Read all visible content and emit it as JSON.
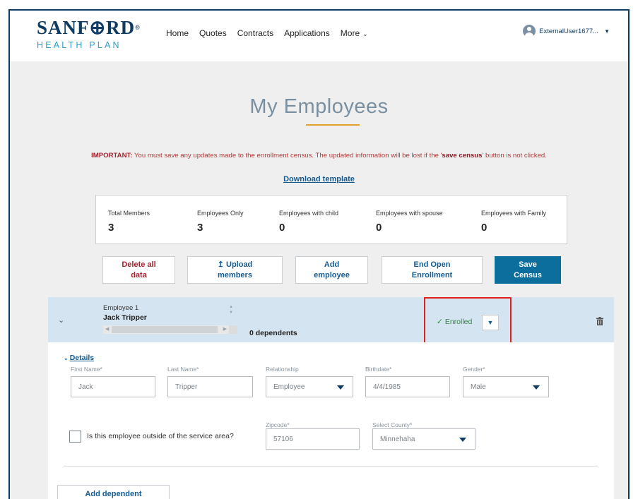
{
  "header": {
    "logo_line1": "SANF⊕RD",
    "logo_line2": "HEALTH PLAN",
    "nav": [
      "Home",
      "Quotes",
      "Contracts",
      "Applications",
      "More"
    ],
    "user_name": "ExternalUser1677..."
  },
  "page_title": "My Employees",
  "notice": {
    "label": "IMPORTANT:",
    "text_before": " You must save any updates made to the enrollment census. The updated information will be lost if the '",
    "strong": "save census",
    "text_after": "' button is not clicked."
  },
  "download_link": "Download template",
  "stats": [
    {
      "label": "Total Members",
      "value": "3"
    },
    {
      "label": "Employees Only",
      "value": "3"
    },
    {
      "label": "Employees with child",
      "value": "0"
    },
    {
      "label": "Employees with spouse",
      "value": "0"
    },
    {
      "label": "Employees with Family",
      "value": "0"
    }
  ],
  "actions": {
    "delete_all": "Delete all data",
    "upload": "Upload members",
    "add_employee": "Add employee",
    "end_enrollment": "End Open Enrollment",
    "save_census": "Save Census"
  },
  "employee": {
    "label": "Employee 1",
    "name": "Jack Tripper",
    "dependents": "0 dependents",
    "status": "Enrolled"
  },
  "details": {
    "toggle": "Details",
    "fields": {
      "first_name": {
        "label": "First Name*",
        "value": "Jack"
      },
      "last_name": {
        "label": "Last Name*",
        "value": "Tripper"
      },
      "relationship": {
        "label": "Relationship",
        "value": "Employee"
      },
      "birthdate": {
        "label": "Birthdate*",
        "value": "4/4/1985"
      },
      "gender": {
        "label": "Gender*",
        "value": "Male"
      },
      "zipcode": {
        "label": "Zipcode*",
        "value": "57106"
      },
      "county": {
        "label": "Select County*",
        "value": "Minnehaha"
      }
    },
    "outside_area": "Is this employee outside of the service area?",
    "add_dependent": "Add dependent"
  },
  "colors": {
    "brand_navy": "#0f3b63",
    "accent_gold": "#e2a12a",
    "link_blue": "#135b93",
    "save_blue": "#0b6e9c",
    "alert_red": "#a2242f",
    "enrolled_green": "#2f8a3c",
    "highlight_red": "#e0201f"
  }
}
